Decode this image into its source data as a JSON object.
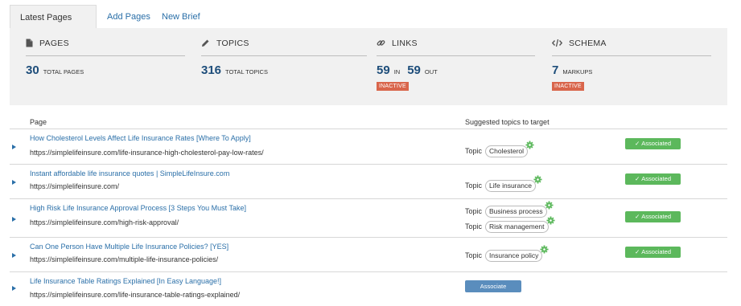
{
  "tabs": {
    "active": "Latest Pages (30)",
    "items": [
      "Add Pages",
      "New Brief"
    ]
  },
  "stats": {
    "pages": {
      "label": "PAGES",
      "value": "30",
      "caption": "TOTAL PAGES"
    },
    "topics": {
      "label": "TOPICS",
      "value": "316",
      "caption": "TOTAL TOPICS"
    },
    "links": {
      "label": "LINKS",
      "in_value": "59",
      "in_caption": "IN",
      "out_value": "59",
      "out_caption": "OUT",
      "status": "INACTIVE"
    },
    "schema": {
      "label": "SCHEMA",
      "value": "7",
      "caption": "MARKUPS",
      "status": "INACTIVE"
    }
  },
  "table": {
    "col_page": "Page",
    "col_topics": "Suggested topics to target",
    "topic_label": "Topic",
    "associated_label": "Associated",
    "associate_label": "Associate",
    "rows": [
      {
        "title": "How Cholesterol Levels Affect Life Insurance Rates [Where To Apply]",
        "url": "https://simplelifeinsure.com/life-insurance-high-cholesterol-pay-low-rates/",
        "topics": [
          "Cholesterol"
        ],
        "status": "associated"
      },
      {
        "title": "Instant affordable life insurance quotes | SimpleLifeInsure.com",
        "url": "https://simplelifeinsure.com/",
        "topics": [
          "Life insurance"
        ],
        "status": "associated"
      },
      {
        "title": "High Risk Life Insurance Approval Process [3 Steps You Must Take]",
        "url": "https://simplelifeinsure.com/high-risk-approval/",
        "topics": [
          "Business process",
          "Risk management"
        ],
        "status": "associated"
      },
      {
        "title": "Can One Person Have Multiple Life Insurance Policies? [YES]",
        "url": "https://simplelifeinsure.com/multiple-life-insurance-policies/",
        "topics": [
          "Insurance policy"
        ],
        "status": "associated"
      },
      {
        "title": "Life Insurance Table Ratings Explained [In Easy Language!]",
        "url": "https://simplelifeinsure.com/life-insurance-table-ratings-explained/",
        "topics": [],
        "status": "associate"
      }
    ]
  }
}
